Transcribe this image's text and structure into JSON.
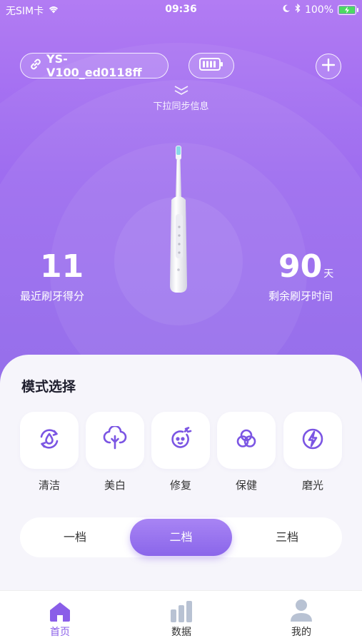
{
  "status_bar": {
    "carrier": "无SIM卡",
    "time": "09:36",
    "battery_percent": "100%",
    "battery_level": 1.0,
    "charging": true
  },
  "header": {
    "device_name": "YS-V100_ed0118ff",
    "pull_hint": "下拉同步信息"
  },
  "stats": {
    "score_value": "11",
    "score_label": "最近刷牙得分",
    "remaining_value": "90",
    "remaining_unit": "天",
    "remaining_label": "剩余刷牙时间"
  },
  "modes": {
    "title": "模式选择",
    "items": [
      {
        "label": "清洁",
        "icon": "clean-icon"
      },
      {
        "label": "美白",
        "icon": "whitening-icon"
      },
      {
        "label": "修复",
        "icon": "repair-icon"
      },
      {
        "label": "保健",
        "icon": "care-icon"
      },
      {
        "label": "磨光",
        "icon": "polish-icon"
      }
    ]
  },
  "gears": {
    "items": [
      "一档",
      "二档",
      "三档"
    ],
    "selected": "二档"
  },
  "tabbar": {
    "items": [
      {
        "label": "首页",
        "icon": "home-icon"
      },
      {
        "label": "数据",
        "icon": "data-icon"
      },
      {
        "label": "我的",
        "icon": "profile-icon"
      }
    ],
    "active": "首页"
  },
  "colors": {
    "accent": "#8a5ee8",
    "hero_top": "#b27cf3",
    "hero_bottom": "#8a5ee8",
    "card_bg": "#f6f5fb"
  }
}
